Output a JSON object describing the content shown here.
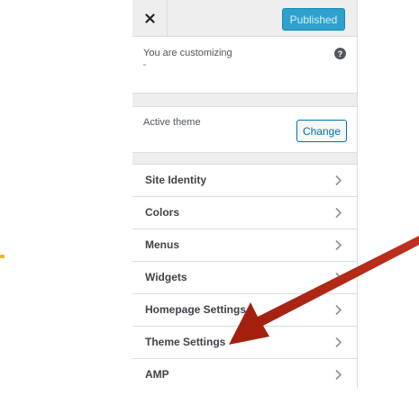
{
  "header": {
    "publish_label": "Published"
  },
  "info": {
    "customizing_text": "You are customizing"
  },
  "theme": {
    "label": "Active theme",
    "change_label": "Change"
  },
  "menu": {
    "items": [
      {
        "label": "Site Identity"
      },
      {
        "label": "Colors"
      },
      {
        "label": "Menus"
      },
      {
        "label": "Widgets"
      },
      {
        "label": "Homepage Settings"
      },
      {
        "label": "Theme Settings"
      },
      {
        "label": "AMP"
      }
    ]
  },
  "colors": {
    "publish_button": "#2ea2cc",
    "change_button": "#0073aa",
    "arrow": "#b52b1c"
  },
  "icons": {
    "close": "close-icon",
    "help": "help-icon",
    "chevron": "chevron-right-icon"
  }
}
